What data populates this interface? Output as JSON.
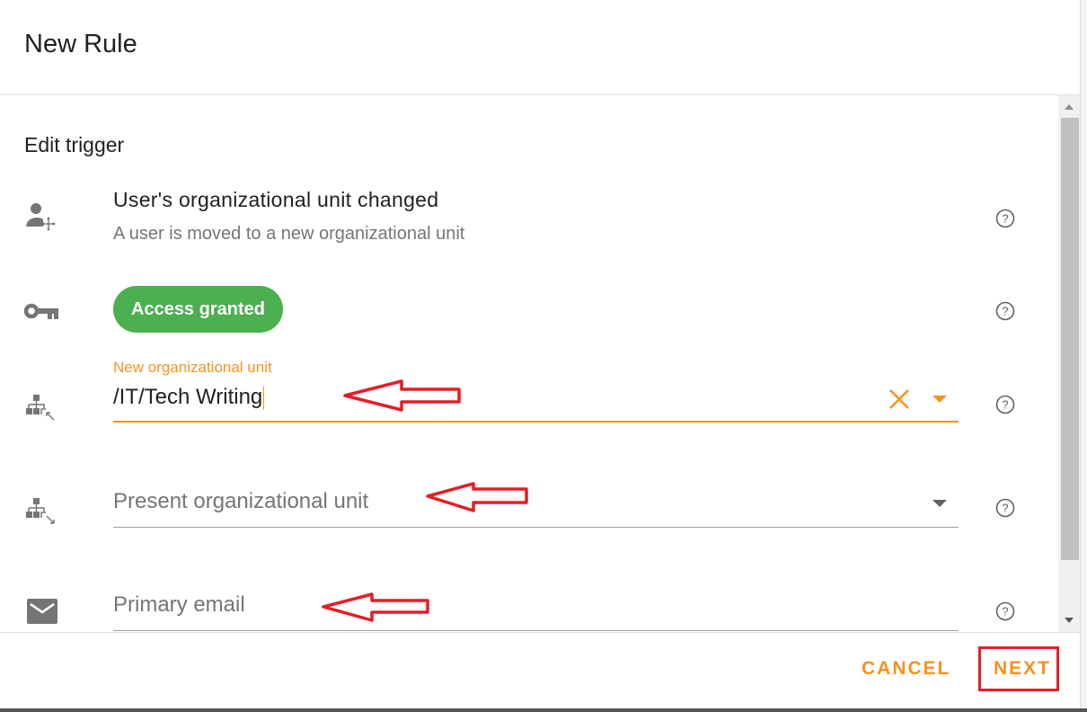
{
  "dialog": {
    "title": "New Rule"
  },
  "content": {
    "section_title": "Edit trigger",
    "trigger": {
      "icon": "user-move-icon",
      "title": "User's organizational unit changed",
      "description": "A user is moved to a new organizational unit"
    },
    "access": {
      "icon": "key-icon",
      "chip_label": "Access granted",
      "chip_color": "#4caf50"
    },
    "fields": [
      {
        "icon": "org-unit-new-icon",
        "label": "New organizational unit",
        "value": "/IT/Tech Writing",
        "focused": true,
        "has_clear": true,
        "has_dropdown": true
      },
      {
        "icon": "org-unit-present-icon",
        "placeholder": "Present organizational unit",
        "value": "",
        "has_dropdown": true
      },
      {
        "icon": "email-icon",
        "placeholder": "Primary email",
        "value": ""
      }
    ]
  },
  "footer": {
    "cancel_label": "CANCEL",
    "next_label": "NEXT"
  },
  "colors": {
    "accent": "#f7931e",
    "annotation": "#e41e26",
    "icon_gray": "#757575"
  }
}
